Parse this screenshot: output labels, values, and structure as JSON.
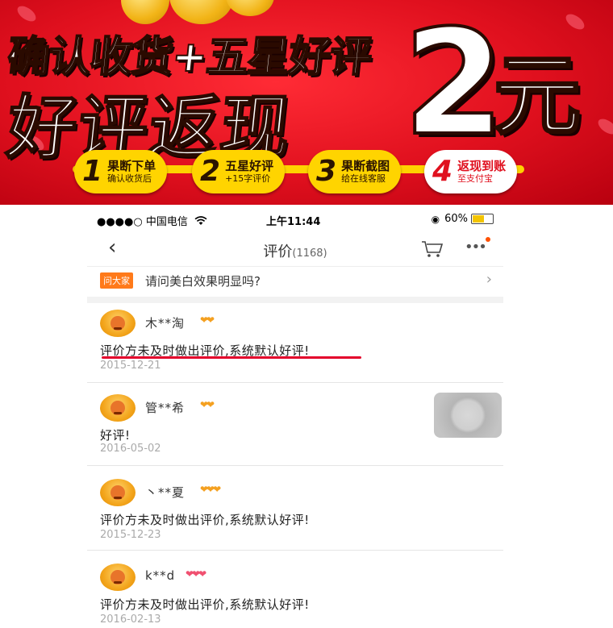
{
  "banner": {
    "line1": "确认收货+五星好评",
    "line2": "好评返现",
    "amount": "2",
    "unit": "元",
    "steps": [
      {
        "num": "1",
        "title": "果断下单",
        "sub": "确认收货后"
      },
      {
        "num": "2",
        "title": "五星好评",
        "sub": "+15字评价"
      },
      {
        "num": "3",
        "title": "果断截图",
        "sub": "给在线客服"
      },
      {
        "num": "4",
        "title": "返现到账",
        "sub": "至支付宝"
      }
    ]
  },
  "statusbar": {
    "carrier": "●●●●○ 中国电信",
    "wifi_icon": "wifi-icon",
    "time": "上午11:44",
    "battery": "60%",
    "battery_level": 0.6
  },
  "nav": {
    "back_icon": "‹",
    "title": "评价",
    "count": "(1168)",
    "cart_icon": "cart-icon",
    "more_icon": "•••"
  },
  "question": {
    "badge": "问大家",
    "text": "请问美白效果明显吗?",
    "arrow": "›"
  },
  "reviews": [
    {
      "user": "木**淘",
      "level": "❤❤",
      "text": "评价方未及时做出评价,系统默认好评!",
      "date": "2015-12-21"
    },
    {
      "user": "管**希",
      "level": "❤❤",
      "text": "好评!",
      "date": "2016-05-02"
    },
    {
      "user": "丶**夏",
      "level": "❤❤❤",
      "text": "评价方未及时做出评价,系统默认好评!",
      "date": "2015-12-23"
    },
    {
      "user": "k**d",
      "level": "❤❤❤",
      "text": "评价方未及时做出评价,系统默认好评!",
      "date": "2016-02-13"
    }
  ],
  "colors": {
    "banner_red": "#e0101e",
    "accent_yellow": "#ffd400",
    "underline_red": "#e3002b",
    "badge_orange": "#ff7a1a"
  }
}
